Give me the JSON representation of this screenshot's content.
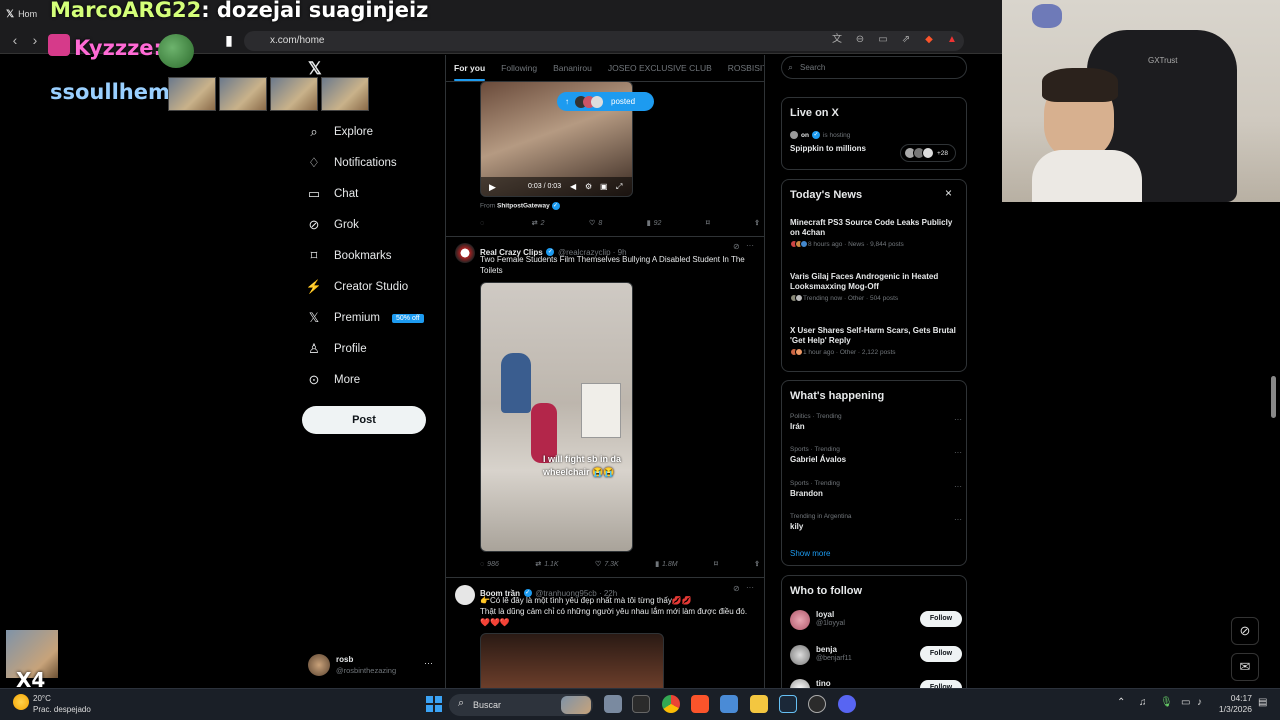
{
  "browser": {
    "tab_label": "Hom",
    "url": "x.com/home"
  },
  "overlay": {
    "chat_title_user": "MarcoARG22",
    "chat_title_text": ": dozejai suaginjeiz",
    "chat_user2": "Kyzzze:",
    "chat_user3": "ssoullhem:",
    "multiplier": "X4"
  },
  "nav": {
    "items": [
      {
        "label": "Explore",
        "icon": "search-icon"
      },
      {
        "label": "Notifications",
        "icon": "bell-icon"
      },
      {
        "label": "Chat",
        "icon": "chat-icon"
      },
      {
        "label": "Grok",
        "icon": "grok-icon"
      },
      {
        "label": "Bookmarks",
        "icon": "bookmark-icon"
      },
      {
        "label": "Creator Studio",
        "icon": "creator-icon"
      },
      {
        "label": "Premium",
        "icon": "x-icon"
      },
      {
        "label": "Profile",
        "icon": "person-icon"
      },
      {
        "label": "More",
        "icon": "more-icon"
      }
    ],
    "premium_badge": "50% off",
    "post_button": "Post",
    "account_name": "rosb",
    "account_handle": "@rosbinthezazing",
    "account_more": "···"
  },
  "timeline": {
    "tabs": [
      "For you",
      "Following",
      "Bananirou",
      "JOSEO EXCLUSIVE CLUB",
      "ROSBISITOS"
    ],
    "posted_pill": "posted",
    "first_post": {
      "video_time": "0:03 / 0:03",
      "from_label": "From",
      "from_source": "ShitpostGateway",
      "replies": "",
      "reposts": "2",
      "likes": "8",
      "views": "92"
    },
    "second_post": {
      "name": "Real Crazy Clips",
      "handle": "@realcrazyclip · 9h",
      "text": "Two Female Students Film Themselves Bullying A Disabled Student In The Toilets",
      "video_caption": "I will fight sb in da wheelchair 😭😭",
      "replies": "986",
      "reposts": "1.1K",
      "likes": "7.3K",
      "views": "1.8M"
    },
    "third_post": {
      "name": "Boom trần",
      "handle": "@tranhuong95cb · 22h",
      "text_line1": "👉Có lẽ đây là một tình yêu đẹp nhất mà tôi từng thấy💋💋",
      "text_line2": "Thật là dũng cảm chỉ có những người yêu nhau lắm mới làm được điều đó.",
      "text_line3": "❤️❤️❤️"
    }
  },
  "sidebar": {
    "search_placeholder": "Search",
    "live": {
      "title": "Live on X",
      "host_line": "on",
      "host_suffix": "is hosting",
      "show": "Spippkin to millions",
      "count": "+28"
    },
    "news": {
      "title": "Today's News",
      "close": "×",
      "items": [
        {
          "title": "Minecraft PS3 Source Code Leaks Publicly on 4chan",
          "meta": "8 hours ago · News · 9,844 posts"
        },
        {
          "title": "Varis Gilaj Faces Androgenic in Heated Looksmaxxing Mog-Off",
          "meta": "Trending now · Other · 504 posts"
        },
        {
          "title": "X User Shares Self-Harm Scars, Gets Brutal 'Get Help' Reply",
          "meta": "1 hour ago · Other · 2,122 posts"
        }
      ]
    },
    "happening": {
      "title": "What's happening",
      "items": [
        {
          "context": "Politics · Trending",
          "name": "Irán"
        },
        {
          "context": "Sports · Trending",
          "name": "Gabriel Ávalos"
        },
        {
          "context": "Sports · Trending",
          "name": "Brandon"
        },
        {
          "context": "Trending in Argentina",
          "name": "kily"
        }
      ],
      "show_more": "Show more"
    },
    "who_to_follow": {
      "title": "Who to follow",
      "follow_label": "Follow",
      "users": [
        {
          "name": "loyal",
          "handle": "@1loyyal"
        },
        {
          "name": "benja",
          "handle": "@benjarf11"
        },
        {
          "name": "tino",
          "handle": ""
        }
      ]
    }
  },
  "taskbar": {
    "weather_temp": "20°C",
    "weather_desc": "Prac. despejado",
    "search": "Buscar",
    "time": "04:17",
    "date": "1/3/2026"
  },
  "webcam": {
    "chair_brand": "GXTrust"
  },
  "colors": {
    "accent": "#1d9bf0",
    "background": "#000000",
    "border": "#2f3336",
    "muted": "#71767b"
  }
}
